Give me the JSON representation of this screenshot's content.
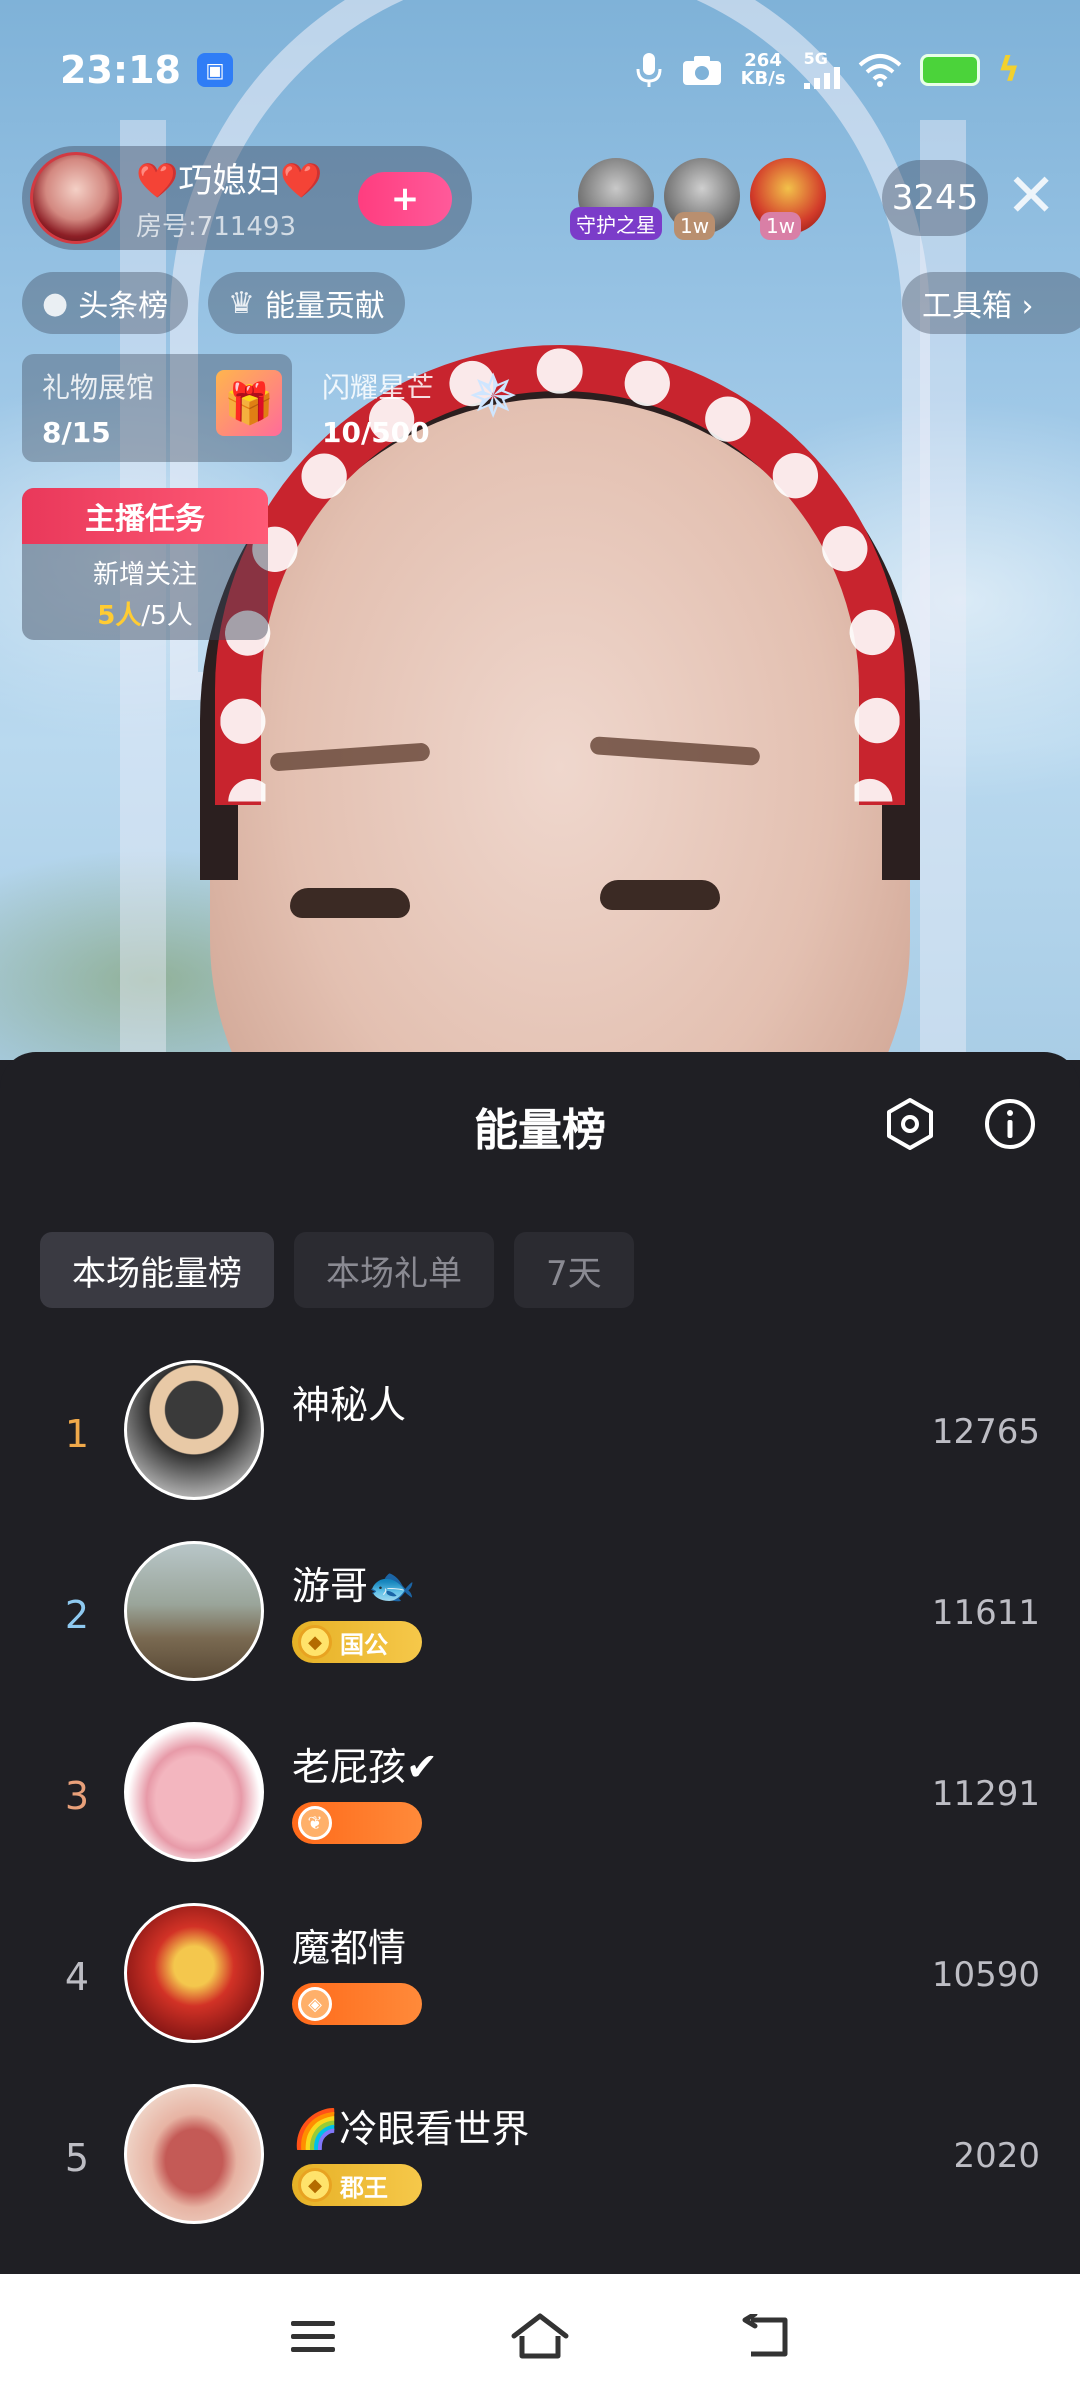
{
  "status_bar": {
    "time": "23:18",
    "net_speed_value": "264",
    "net_speed_unit": "KB/s",
    "network": "5G"
  },
  "host": {
    "name": "❤️巧媳妇❤️",
    "room": "房号:711493",
    "follow_label": "+"
  },
  "viewers": {
    "badges": [
      "守护之星",
      "1w",
      "1w"
    ],
    "count": "3245"
  },
  "chips": {
    "headline": "头条榜",
    "energy": "能量贡献",
    "toolbox": "工具箱 ›"
  },
  "cards": {
    "gift_hall_title": "礼物展馆",
    "gift_hall_value": "8/15",
    "shine_title": "闪耀星芒",
    "shine_value": "10/500"
  },
  "task": {
    "title": "主播任务",
    "subtitle": "新增关注",
    "progress_done": "5人",
    "progress_total": "/5人"
  },
  "sheet": {
    "title": "能量榜",
    "tabs": [
      "本场能量榜",
      "本场礼单",
      "7天"
    ]
  },
  "ranking": [
    {
      "rank": "1",
      "name": "神秘人",
      "score": "12765",
      "badge": ""
    },
    {
      "rank": "2",
      "name": "游哥🐟",
      "score": "11611",
      "badge": "国公"
    },
    {
      "rank": "3",
      "name": "老屁孩✔",
      "score": "11291",
      "badge": ""
    },
    {
      "rank": "4",
      "name": "魔都情",
      "score": "10590",
      "badge": ""
    },
    {
      "rank": "5",
      "name": "🌈冷眼看世界",
      "score": "2020",
      "badge": "郡王"
    }
  ],
  "colors": {
    "rank1": "#f0a94a",
    "rank2": "#8ec9f0",
    "rank3": "#e8a07a",
    "rank_other": "#bdbdc4",
    "accent_pink": "#ff3d7f",
    "badge_gold": "#e6b126",
    "badge_orange": "#ff6a1a"
  },
  "icons": [
    "cast-icon",
    "mic-icon",
    "camera-icon",
    "signal-icon",
    "wifi-icon",
    "battery-icon",
    "charging-icon",
    "close-icon",
    "fire-icon",
    "crown-icon",
    "gift-icon",
    "star-icon",
    "settings-icon",
    "info-icon",
    "menu-icon",
    "home-icon",
    "back-icon"
  ]
}
